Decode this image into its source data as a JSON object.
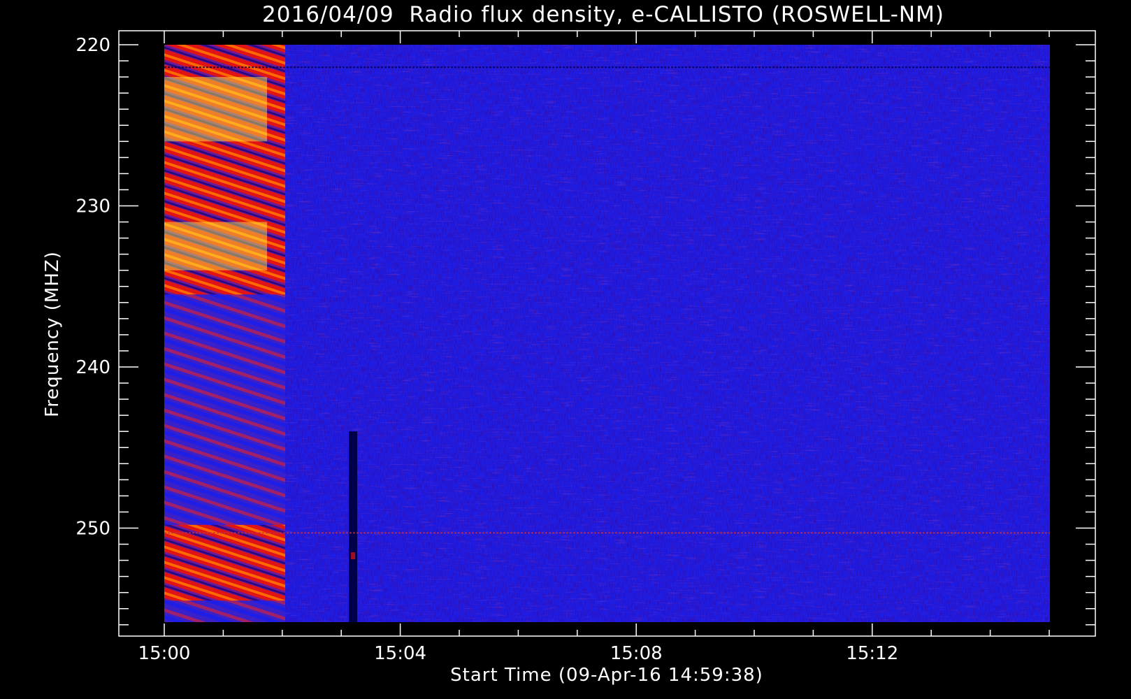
{
  "chart_data": {
    "type": "heatmap",
    "title": "2016/04/09  Radio flux density, e-CALLISTO (ROSWELL-NM)",
    "xlabel": "Start Time (09-Apr-16 14:59:38)",
    "ylabel": "Frequency (MHZ)",
    "x_ticks": [
      "15:00",
      "15:04",
      "15:08",
      "15:12"
    ],
    "y_ticks": [
      "220",
      "230",
      "240",
      "250"
    ],
    "x_range_minutes": [
      0,
      15
    ],
    "y_range_mhz": [
      220,
      256
    ],
    "y_inverted": true,
    "grid": false,
    "colors": {
      "background": "#000000",
      "quiet": "#1e1ee6",
      "dark": "#00004a",
      "purple": "#6a1a9a",
      "red": "#e01414",
      "orange": "#ff6a00",
      "yellow": "#ffff40"
    },
    "features": [
      {
        "name": "banded emission",
        "time_range_minutes": [
          0,
          2.05
        ],
        "freq_range_mhz": [
          220,
          256
        ]
      },
      {
        "name": "dark vertical burst",
        "time_minutes": 3.2,
        "freq_range_mhz": [
          244,
          256
        ]
      },
      {
        "name": "horizontal interference",
        "freq_mhz": 221.4
      },
      {
        "name": "horizontal interference",
        "freq_mhz": 250.3
      }
    ]
  }
}
